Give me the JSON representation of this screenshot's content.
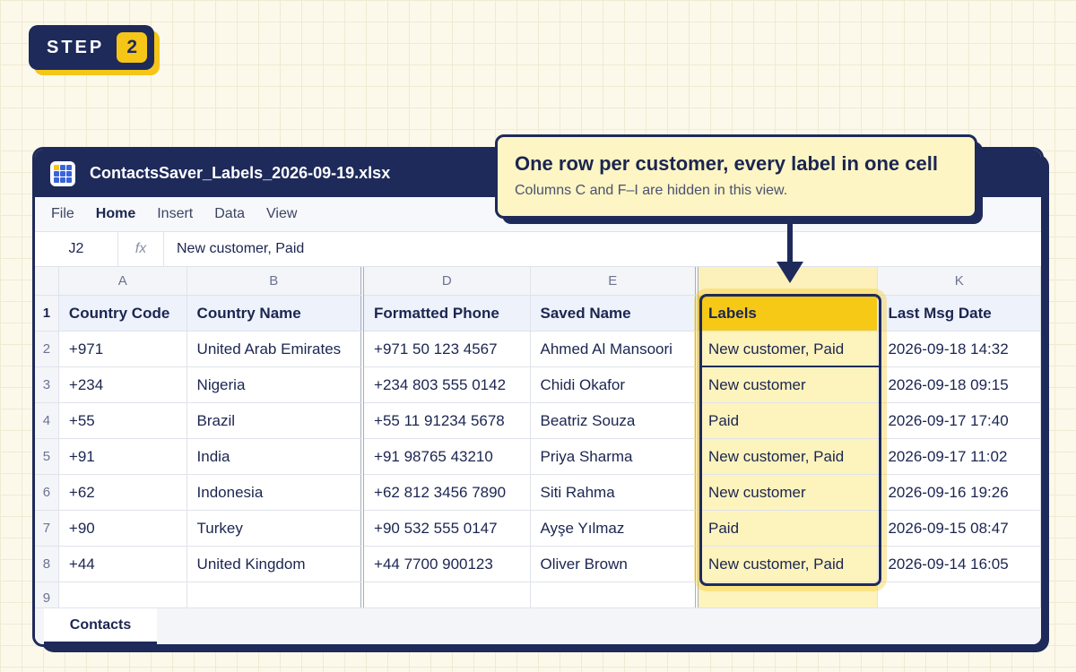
{
  "step": {
    "label": "STEP",
    "number": "2"
  },
  "window": {
    "title": "ContactsSaver_Labels_2026-09-19.xlsx",
    "icon": "spreadsheet-icon"
  },
  "menu": [
    "File",
    "Home",
    "Insert",
    "Data",
    "View"
  ],
  "menu_active": "Home",
  "formula_bar": {
    "cell_ref": "J2",
    "fx": "fx",
    "value": "New customer, Paid"
  },
  "callout": {
    "title": "One row per customer, every label in one cell",
    "subtitle": "Columns C and F–I are hidden in this view."
  },
  "columns": [
    "A",
    "B",
    "D",
    "E",
    "",
    "K"
  ],
  "row_numbers": [
    "1",
    "2",
    "3",
    "4",
    "5",
    "6",
    "7",
    "8",
    "9"
  ],
  "headers": [
    "Country Code",
    "Country Name",
    "Formatted Phone",
    "Saved Name",
    "Labels",
    "Last Msg Date"
  ],
  "rows": [
    [
      "+971",
      "United Arab Emirates",
      "+971 50 123 4567",
      "Ahmed Al Mansoori",
      "New customer, Paid",
      "2026-09-18 14:32"
    ],
    [
      "+234",
      "Nigeria",
      "+234 803 555 0142",
      "Chidi Okafor",
      "New customer",
      "2026-09-18 09:15"
    ],
    [
      "+55",
      "Brazil",
      "+55 11 91234 5678",
      "Beatriz Souza",
      "Paid",
      "2026-09-17 17:40"
    ],
    [
      "+91",
      "India",
      "+91 98765 43210",
      "Priya Sharma",
      "New customer, Paid",
      "2026-09-17 11:02"
    ],
    [
      "+62",
      "Indonesia",
      "+62 812 3456 7890",
      "Siti Rahma",
      "New customer",
      "2026-09-16 19:26"
    ],
    [
      "+90",
      "Turkey",
      "+90 532 555 0147",
      "Ayşe Yılmaz",
      "Paid",
      "2026-09-15 08:47"
    ],
    [
      "+44",
      "United Kingdom",
      "+44 7700 900123",
      "Oliver Brown",
      "New customer, Paid",
      "2026-09-14 16:05"
    ]
  ],
  "sheet_tab": "Contacts",
  "colors": {
    "navy": "#1e2a5a",
    "accent_yellow": "#f5c518",
    "labels_fill": "#fdf3bd"
  }
}
